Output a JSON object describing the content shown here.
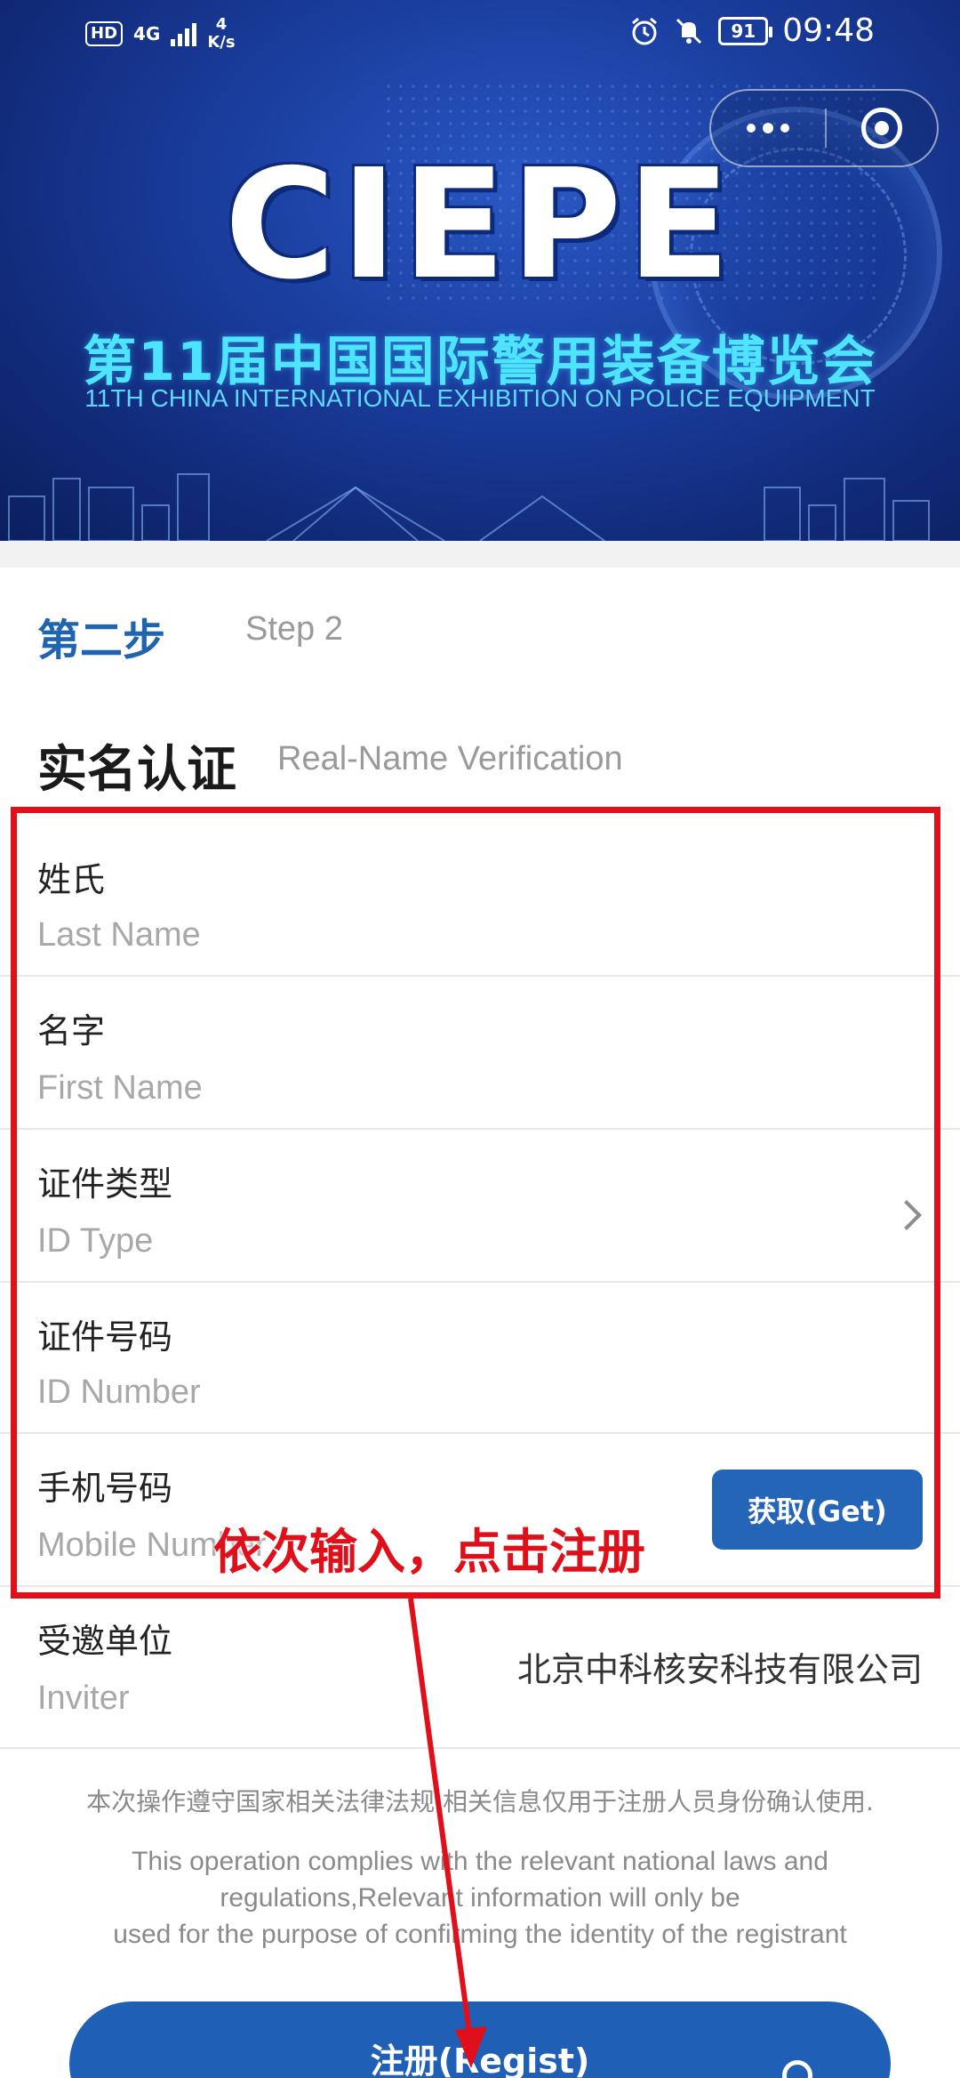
{
  "status_bar": {
    "hd": "HD",
    "network": "4G",
    "speed_value": "4",
    "speed_unit": "K/s",
    "battery": "91",
    "time": "09:48"
  },
  "banner": {
    "logo": "CIEPE",
    "title_cn": "第11届中国国际警用装备博览会",
    "title_en": "11TH CHINA INTERNATIONAL EXHIBITION ON POLICE EQUIPMENT"
  },
  "step": {
    "cn": "第二步",
    "en": "Step 2"
  },
  "section": {
    "cn": "实名认证",
    "en": "Real-Name Verification"
  },
  "fields": {
    "last_name": {
      "label": "姓氏",
      "placeholder": "Last Name"
    },
    "first_name": {
      "label": "名字",
      "placeholder": "First Name"
    },
    "id_type": {
      "label": "证件类型",
      "placeholder": "ID Type"
    },
    "id_number": {
      "label": "证件号码",
      "placeholder": "ID Number"
    },
    "mobile": {
      "label": "手机号码",
      "placeholder": "Mobile Number",
      "get_button": "获取(Get)"
    },
    "inviter": {
      "label": "受邀单位",
      "placeholder": "Inviter",
      "value": "北京中科核安科技有限公司"
    }
  },
  "notice": {
    "cn": "本次操作遵守国家相关法律法规,相关信息仅用于注册人员身份确认使用.",
    "en_line1": "This operation complies with the relevant national laws and",
    "en_line2": "regulations,Relevant information will only be",
    "en_line3": "used for the purpose of confirming the identity of the registrant"
  },
  "register_button": "注册(Regist)",
  "annotation": {
    "text": "依次输入，点击注册",
    "color": "#e0101a"
  },
  "colors": {
    "accent": "#1f64b0",
    "button": "#2565b7",
    "banner_bg": "#1a3e9f",
    "banner_text": "#4ee3ff"
  }
}
